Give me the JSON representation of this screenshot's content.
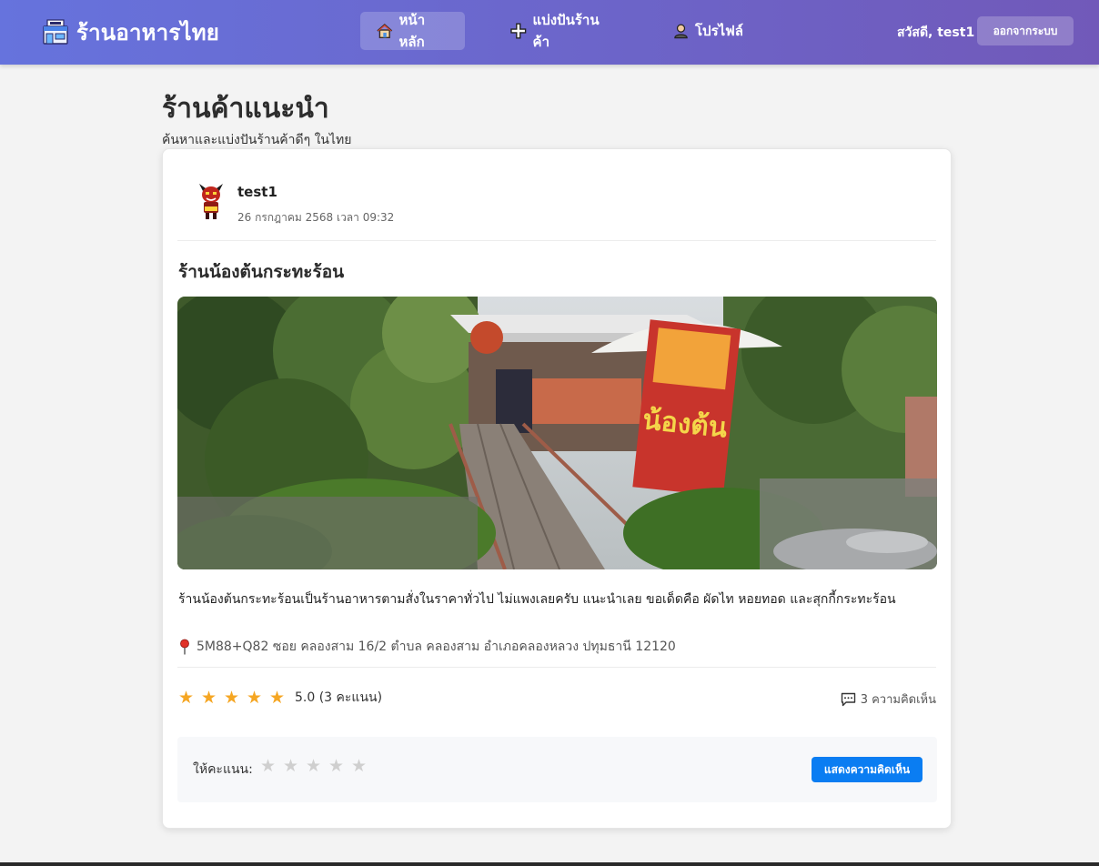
{
  "header": {
    "brand": "ร้านอาหารไทย",
    "nav": [
      {
        "label": "หน้าหลัก",
        "icon": "house-icon",
        "active": true
      },
      {
        "label": "แบ่งปันร้านค้า",
        "icon": "plus-icon",
        "active": false
      },
      {
        "label": "โปรไฟล์",
        "icon": "user-icon",
        "active": false
      }
    ],
    "greeting": "สวัสดี, test1",
    "logout_label": "ออกจากระบบ"
  },
  "page": {
    "title": "ร้านค้าแนะนำ",
    "subtitle": "ค้นหาและแบ่งปันร้านค้าดีๆ ในไทย"
  },
  "post": {
    "author": "test1",
    "date": "26 กรกฎาคม 2568 เวลา 09:32",
    "shop_name": "ร้านน้องต้นกระทะร้อน",
    "photo_sign_text": "น้องต้น",
    "description": "ร้านน้องต้นกระทะร้อนเป็นร้านอาหารตามสั่งในราคาทั่วไป ไม่แพงเลยครับ แนะนำเลย ขอเด็ดคือ ผัดไท หอยทอด และสุกกี้กระทะร้อน",
    "address": "5M88+Q82 ซอย คลองสาม 16/2 ตำบล คลองสาม อำเภอคลองหลวง ปทุมธานี 12120",
    "rating_stars": 5,
    "rating_text": "5.0 (3 คะแนน)",
    "comments_text": "3 ความคิดเห็น"
  },
  "rate_panel": {
    "label": "ให้คะแนน:",
    "show_comments_label": "แสดงความคิดเห็น"
  },
  "colors": {
    "header_start": "#6673dd",
    "header_end": "#7159b9",
    "star": "#f5a623",
    "primary_button": "#0a7df2"
  }
}
